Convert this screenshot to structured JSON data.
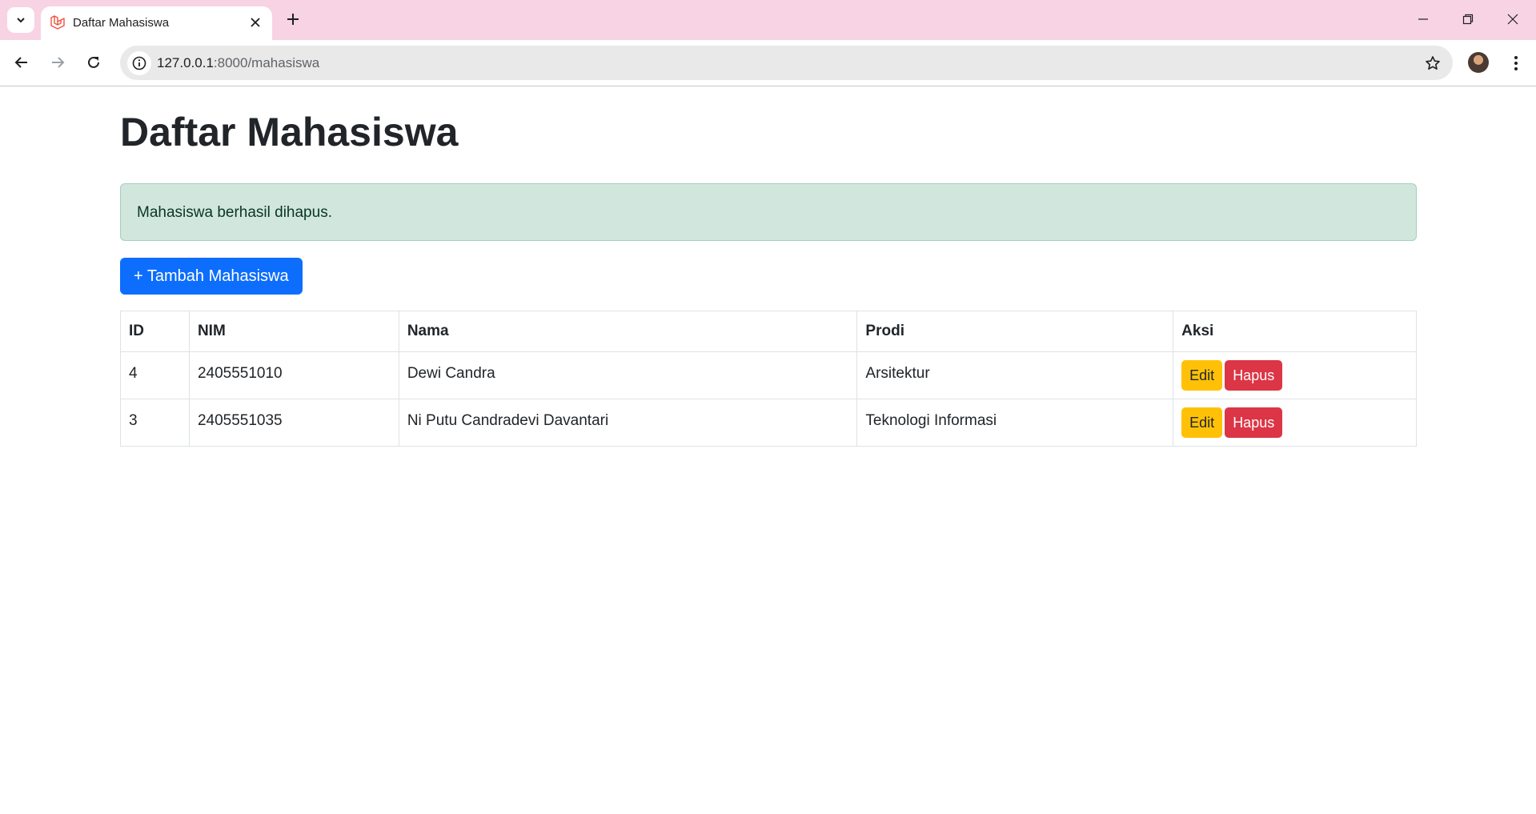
{
  "browser": {
    "tab_title": "Daftar Mahasiswa",
    "url_host": "127.0.0.1",
    "url_path": ":8000/mahasiswa",
    "icons": [
      "chevron-down-icon",
      "laravel-icon",
      "close-icon",
      "plus-icon",
      "minimize-icon",
      "restore-icon",
      "close-window-icon",
      "back-arrow-icon",
      "forward-arrow-icon",
      "reload-icon",
      "info-icon",
      "star-icon",
      "avatar",
      "more-vert-icon"
    ],
    "colors": {
      "tabstrip": "#f7d3e3",
      "omnibox": "#e9e9e9"
    }
  },
  "page": {
    "title": "Daftar Mahasiswa",
    "alert": "Mahasiswa berhasil dihapus.",
    "add_button": "+ Tambah Mahasiswa",
    "table": {
      "headers": [
        "ID",
        "NIM",
        "Nama",
        "Prodi",
        "Aksi"
      ],
      "rows": [
        {
          "id": "4",
          "nim": "2405551010",
          "nama": "Dewi Candra",
          "prodi": "Arsitektur",
          "edit": "Edit",
          "hapus": "Hapus"
        },
        {
          "id": "3",
          "nim": "2405551035",
          "nama": "Ni Putu Candradevi Davantari",
          "prodi": "Teknologi Informasi",
          "edit": "Edit",
          "hapus": "Hapus"
        }
      ]
    },
    "colors": {
      "primary": "#0d6efd",
      "warning": "#ffc107",
      "danger": "#dc3545",
      "success_bg": "#d1e7dd"
    }
  }
}
